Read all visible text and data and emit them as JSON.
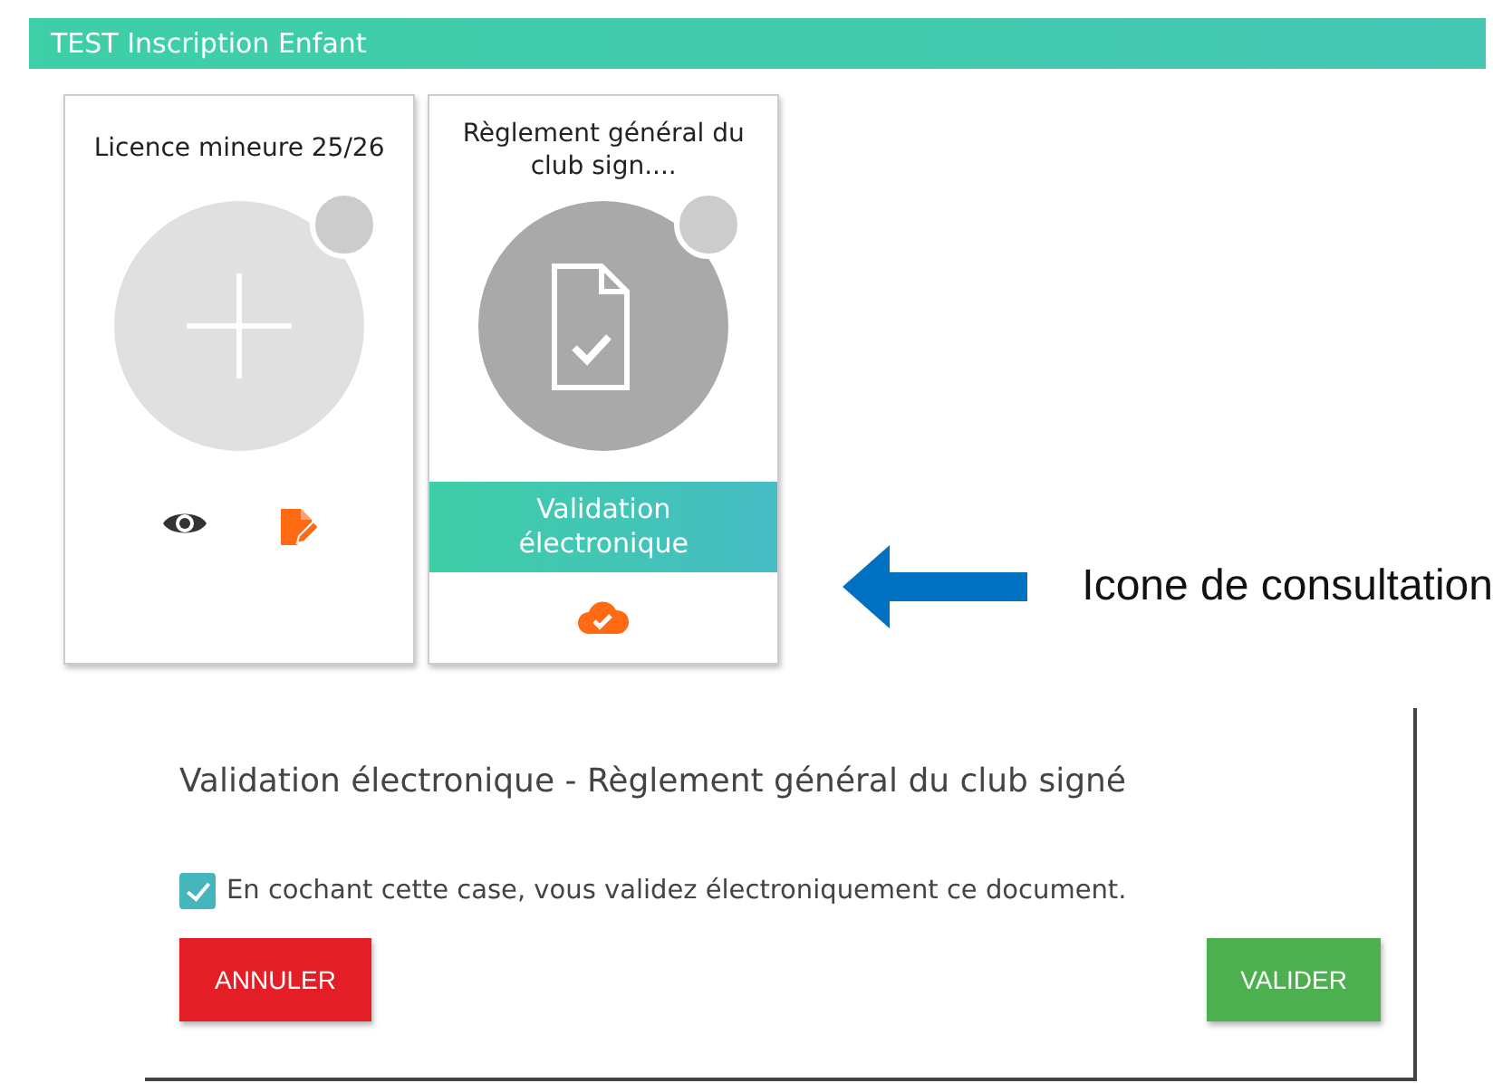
{
  "header": {
    "title": "TEST Inscription Enfant"
  },
  "documents": [
    {
      "title": "Licence mineure 25/26",
      "kind": "empty",
      "actions": [
        {
          "kind": "view"
        },
        {
          "kind": "edit"
        }
      ]
    },
    {
      "title": "Règlement général du club sign....",
      "kind": "validated",
      "status": "Validation électronique",
      "actions": [
        {
          "kind": "cloud-check"
        }
      ]
    }
  ],
  "annotation": {
    "text": "Icone de consultation"
  },
  "dialog": {
    "title": "Validation électronique - Règlement général du club signé",
    "checkbox": {
      "label": "En cochant cette case, vous validez électroniquement ce document.",
      "checked": true
    },
    "buttons": [
      {
        "label": "ANNULER",
        "kind": "cancel"
      },
      {
        "label": "VALIDER",
        "kind": "confirm"
      }
    ]
  }
}
